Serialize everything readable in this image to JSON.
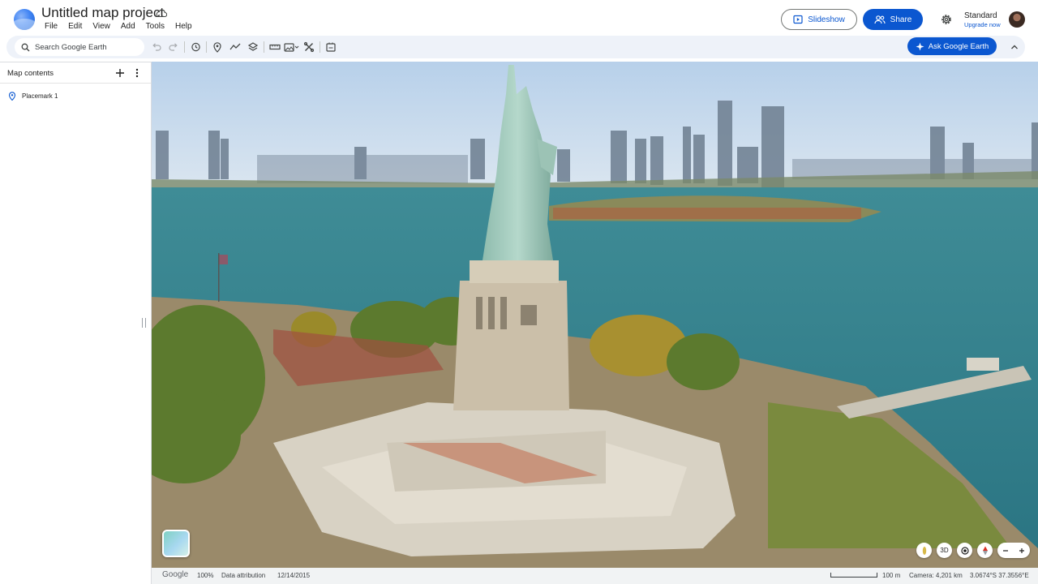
{
  "header": {
    "project_title": "Untitled map project",
    "menu": [
      "File",
      "Edit",
      "View",
      "Add",
      "Tools",
      "Help"
    ],
    "slideshow_label": "Slideshow",
    "share_label": "Share",
    "plan_name": "Standard",
    "upgrade_label": "Upgrade now"
  },
  "toolbar": {
    "search_placeholder": "Search Google Earth",
    "ask_label": "Ask Google Earth",
    "icons": [
      "undo-icon",
      "redo-icon",
      "history-icon",
      "placemark-icon",
      "path-icon",
      "layers-icon",
      "measure-icon",
      "photo-icon",
      "tools-icon",
      "import-icon"
    ]
  },
  "left_panel": {
    "title": "Map contents",
    "items": [
      {
        "label": "Placemark 1",
        "icon": "placemark-icon"
      }
    ]
  },
  "map_controls": {
    "tilt_label": "3D"
  },
  "status_bar": {
    "brand": "Google",
    "zoom": "100%",
    "attribution": "Data attribution",
    "date": "12/14/2015",
    "scale": "100 m",
    "camera": "Camera: 4,201 km",
    "coordinates": "3.0674°S 37.3556°E"
  },
  "colors": {
    "primary": "#0b57d0",
    "toolbar_bg": "#eef2f9",
    "water": "#2f7f8a",
    "sky": "#c9dcef"
  }
}
